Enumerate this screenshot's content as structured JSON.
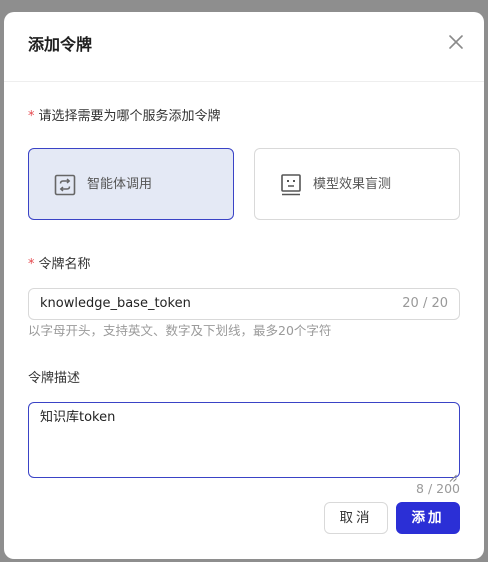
{
  "dialog": {
    "title": "添加令牌",
    "close_icon": "close-icon"
  },
  "service_section": {
    "required_mark": "*",
    "label": "请选择需要为哪个服务添加令牌",
    "options": [
      {
        "label": "智能体调用",
        "icon": "refresh-arrows-icon",
        "selected": true
      },
      {
        "label": "模型效果盲测",
        "icon": "robot-face-icon",
        "selected": false
      }
    ]
  },
  "name_field": {
    "required_mark": "*",
    "label": "令牌名称",
    "value": "knowledge_base_token",
    "counter": "20 / 20",
    "hint": "以字母开头，支持英文、数字及下划线，最多20个字符"
  },
  "desc_field": {
    "label": "令牌描述",
    "value": "知识库token",
    "counter": "8 / 200"
  },
  "footer": {
    "cancel_label": "取消",
    "add_label": "添加"
  },
  "colors": {
    "accent": "#2b2fd6",
    "selected_card_bg": "#e4e9f5",
    "required": "#e5484d",
    "backdrop": "#8e8e8e"
  }
}
